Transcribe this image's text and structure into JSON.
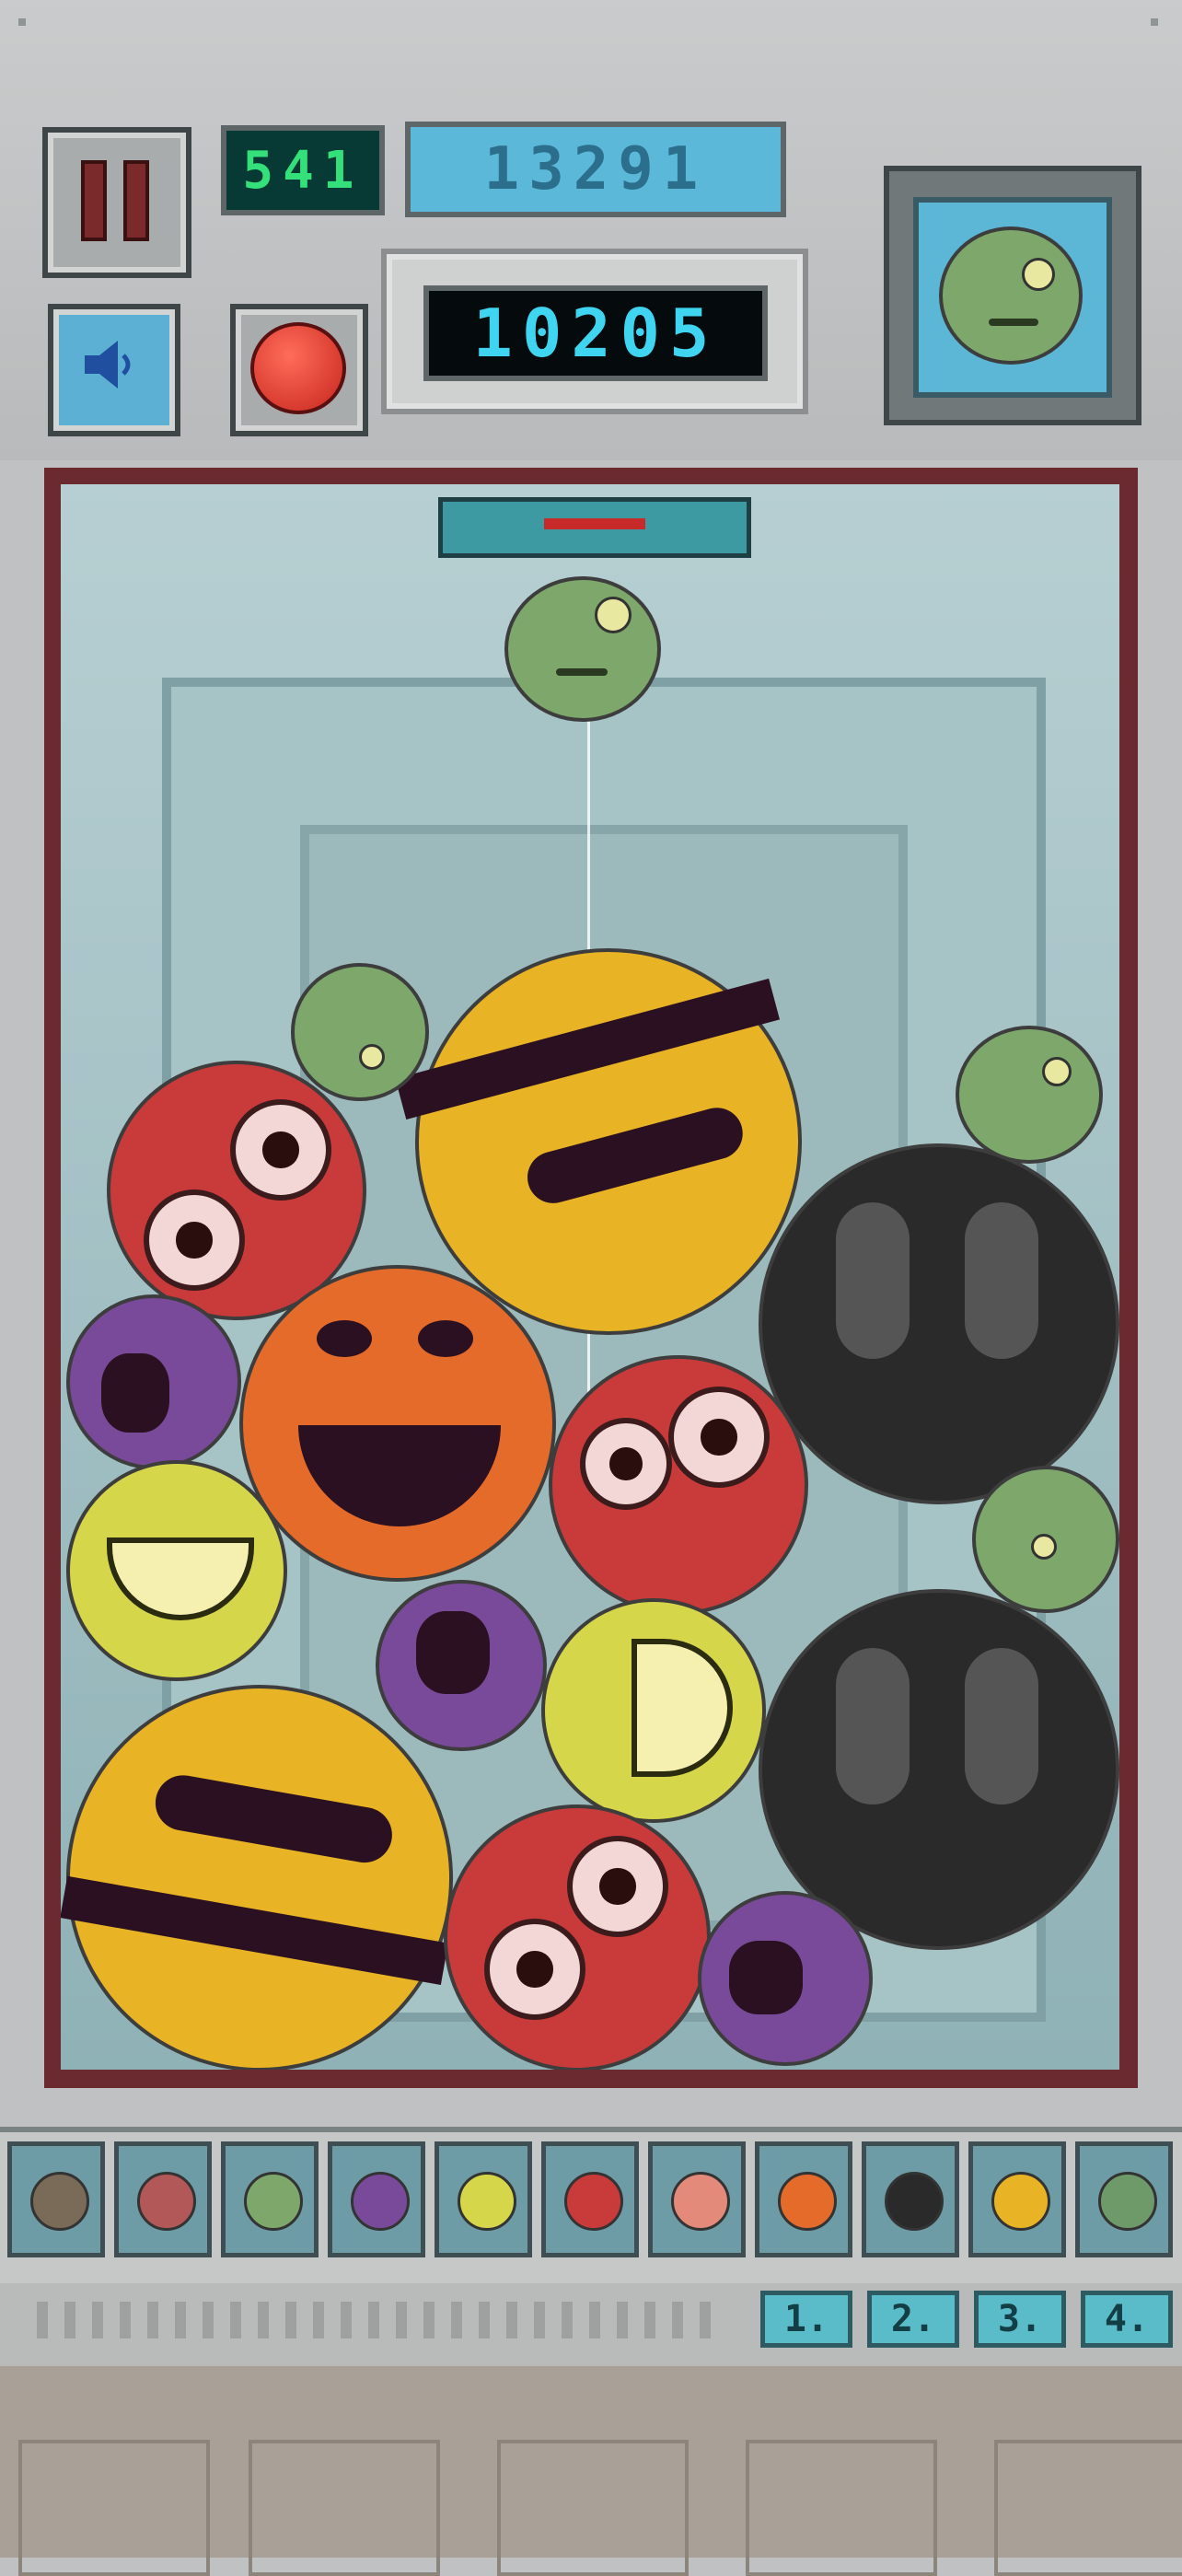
{
  "hud": {
    "left_counter": "541",
    "best_score": "13291",
    "score": "10205"
  },
  "icons": {
    "pause": "pause-icon",
    "sound": "speaker-icon",
    "record": "red-button-icon"
  },
  "evolution_slots": [
    "brown-monster",
    "red-pig-monster",
    "green-blob-monster",
    "purple-monster",
    "yellow-grin-monster",
    "red-eyes-monster",
    "pink-monster",
    "orange-pumpkin-monster",
    "black-skull-monster",
    "yellow-stripe-monster",
    "green-tentacle-monster"
  ],
  "tools": [
    "1.",
    "2.",
    "3.",
    "4."
  ],
  "colors": {
    "red": "#c93a3a",
    "orange": "#e46b2a",
    "yellow": "#e9b326",
    "lime": "#d6d64a",
    "purple": "#7a4a9a",
    "green": "#7daa6a",
    "black": "#2a2a2a"
  }
}
